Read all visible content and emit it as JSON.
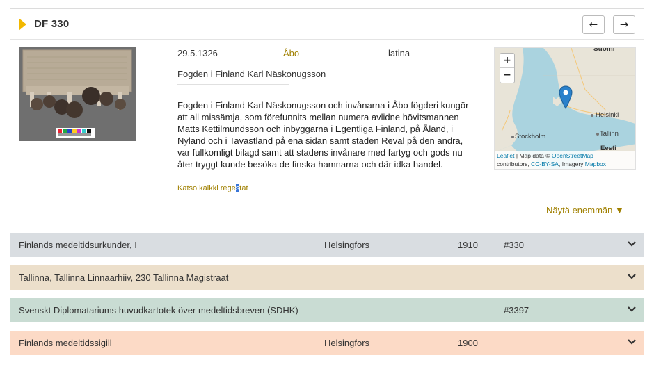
{
  "header": {
    "title": "DF 330",
    "prev_icon": "arrow-left-icon",
    "next_icon": "arrow-right-icon",
    "prev_glyph": "←",
    "next_glyph": "→"
  },
  "document": {
    "date": "29.5.1326",
    "place": "Åbo",
    "language": "latina",
    "issuer": "Fogden i Finland Karl Näskonugsson",
    "summary": "Fogden i Finland Karl Näskonugsson och invånarna i Åbo fögderi kungör att all missämja, som förefunnits mellan numera avlidne hövitsmannen Matts Kettilmundsson och inbyggarna i Egentliga Finland, på Åland, i Nyland och i Tavastland på ena sidan samt staden Reval på den andra, var fullkomligt bilagd samt att stadens invånare med fartyg och gods nu åter tryggt kunde besöka de finska hamnarna och där idka handel.",
    "all_link_pre": "Katso kaikki rege",
    "all_link_sel": "s",
    "all_link_post": "tat",
    "more_label": "Näytä enemmän ▼"
  },
  "map": {
    "zoom_in": "+",
    "zoom_out": "−",
    "labels": {
      "suomi": "Suomi",
      "helsinki": "Helsinki",
      "stockholm": "Stockholm",
      "tallinn": "Tallinn",
      "eesti": "Eesti"
    },
    "attribution": {
      "leaflet": "Leaflet",
      "sep1": " | Map data © ",
      "osm": "OpenStreetMap",
      "contrib": "contributors, ",
      "license": "CC-BY-SA",
      "imagery": ", Imagery ",
      "mapbox": "Mapbox"
    }
  },
  "sources": [
    {
      "name": "Finlands medeltidsurkunder, I",
      "place": "Helsingfors",
      "year": "1910",
      "number": "#330",
      "color": "#d9dde1"
    },
    {
      "name": "Tallinna, Tallinna Linnaarhiiv, 230 Tallinna Magistraat",
      "place": "",
      "year": "",
      "number": "",
      "color": "#ecdfcb"
    },
    {
      "name": "Svenskt Diplomatariums huvudkartotek över medeltidsbreven (SDHK)",
      "place": "",
      "year": "",
      "number": "#3397",
      "color": "#c9dcd3"
    },
    {
      "name": "Finlands medeltidssigill",
      "place": "Helsingfors",
      "year": "1900",
      "number": "",
      "color": "#fcdac6"
    }
  ]
}
